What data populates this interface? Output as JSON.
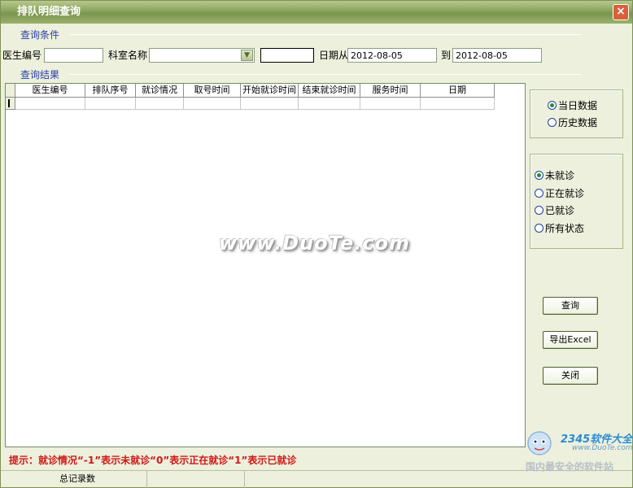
{
  "window": {
    "title": "排队明细查询",
    "close_glyph": "×"
  },
  "conditions": {
    "group_label": "查询条件",
    "doctor_id_label": "医生编号",
    "doctor_id_value": "",
    "dept_label": "科室名称",
    "dept_value": "",
    "extra_value": "",
    "date_from_label": "日期从",
    "date_from_value": "2012-08-05",
    "date_to_label": "到",
    "date_to_value": "2012-08-05"
  },
  "results": {
    "group_label": "查询结果",
    "columns": [
      "医生编号",
      "排队序号",
      "就诊情况",
      "取号时间",
      "开始就诊时间",
      "结束就诊时间",
      "服务时间",
      "日期"
    ]
  },
  "data_source": {
    "options": [
      "当日数据",
      "历史数据"
    ],
    "selected": 0
  },
  "status_filter": {
    "options": [
      "未就诊",
      "正在就诊",
      "已就诊",
      "所有状态"
    ],
    "selected": 0
  },
  "buttons": {
    "query": "查询",
    "export": "导出Excel",
    "close": "关闭"
  },
  "tip": "提示：就诊情况“-1”表示未就诊“0”表示正在就诊“1”表示已就诊",
  "statusbar": {
    "total_label": "总记录数",
    "total_value": ""
  },
  "watermark": "www.DuoTe.com",
  "logo": {
    "brand": "2345软件大全",
    "url": "www.DuoTe.com",
    "slogan": "国内最安全的软件站"
  }
}
